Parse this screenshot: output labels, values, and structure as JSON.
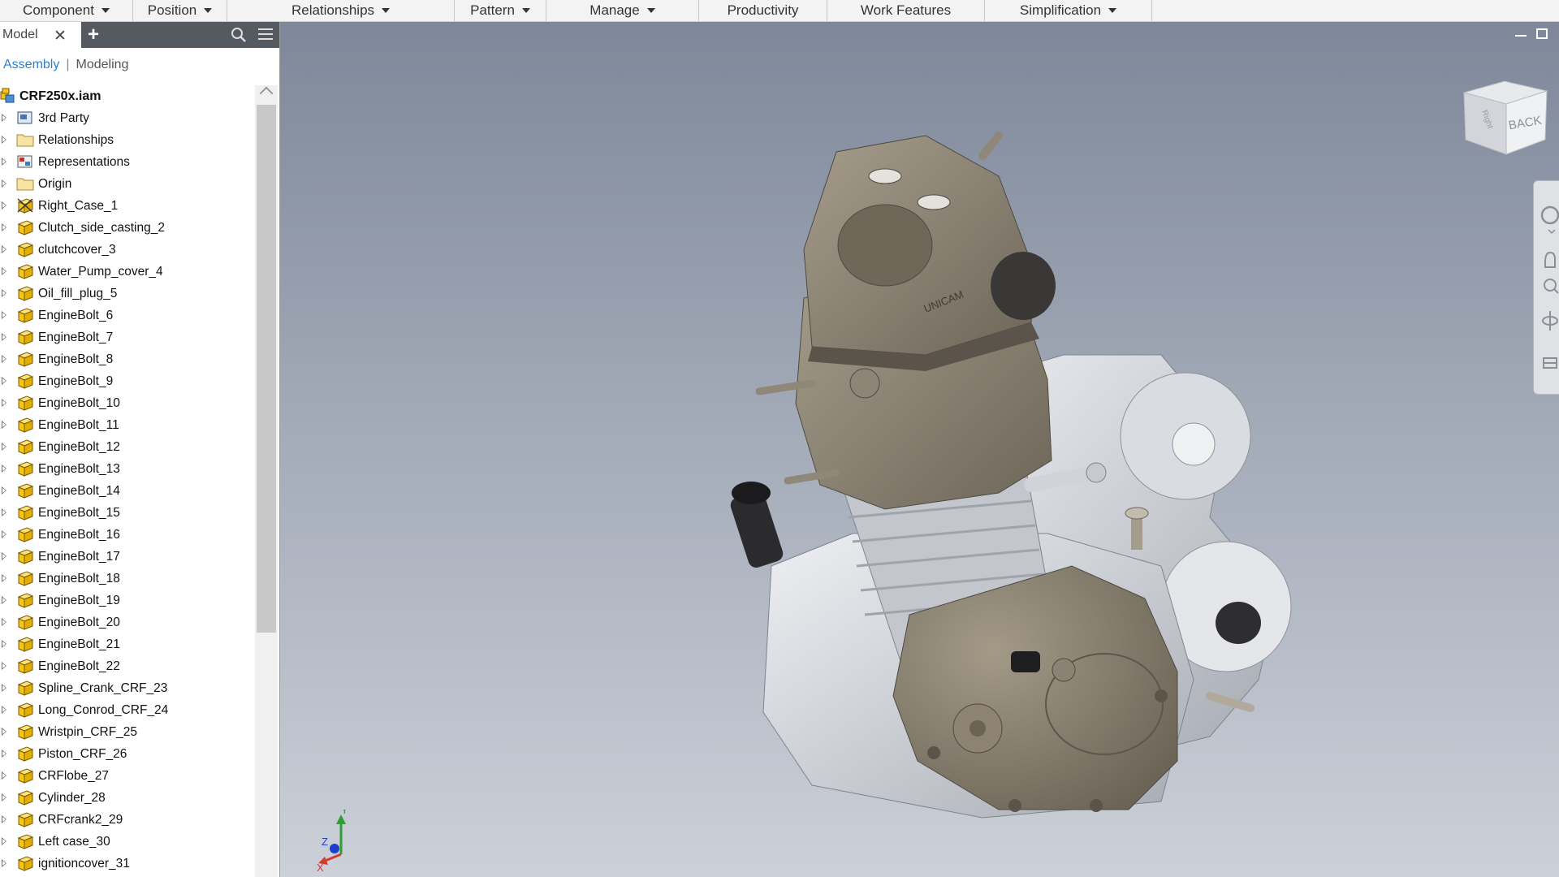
{
  "ribbon": {
    "groups": [
      {
        "label": "Component",
        "dropdown": true
      },
      {
        "label": "Position",
        "dropdown": true
      },
      {
        "label": "Relationships",
        "dropdown": true
      },
      {
        "label": "Pattern",
        "dropdown": true
      },
      {
        "label": "Manage",
        "dropdown": true
      },
      {
        "label": "Productivity",
        "dropdown": false
      },
      {
        "label": "Work Features",
        "dropdown": false
      },
      {
        "label": "Simplification",
        "dropdown": true
      }
    ]
  },
  "browser": {
    "tab_label": "Model",
    "view_assembly": "Assembly",
    "view_modeling": "Modeling",
    "root": "CRF250x.iam",
    "nodes": [
      {
        "label": "3rd Party",
        "icon": "third-party-icon"
      },
      {
        "label": "Relationships",
        "icon": "folder-icon"
      },
      {
        "label": "Representations",
        "icon": "representations-icon"
      },
      {
        "label": "Origin",
        "icon": "folder-icon"
      },
      {
        "label": "Right_Case_1",
        "icon": "grounded-part-icon"
      },
      {
        "label": "Clutch_side_casting_2",
        "icon": "part-icon"
      },
      {
        "label": "clutchcover_3",
        "icon": "part-icon"
      },
      {
        "label": "Water_Pump_cover_4",
        "icon": "part-icon"
      },
      {
        "label": "Oil_fill_plug_5",
        "icon": "part-icon"
      },
      {
        "label": "EngineBolt_6",
        "icon": "part-icon"
      },
      {
        "label": "EngineBolt_7",
        "icon": "part-icon"
      },
      {
        "label": "EngineBolt_8",
        "icon": "part-icon"
      },
      {
        "label": "EngineBolt_9",
        "icon": "part-icon"
      },
      {
        "label": "EngineBolt_10",
        "icon": "part-icon"
      },
      {
        "label": "EngineBolt_11",
        "icon": "part-icon"
      },
      {
        "label": "EngineBolt_12",
        "icon": "part-icon"
      },
      {
        "label": "EngineBolt_13",
        "icon": "part-icon"
      },
      {
        "label": "EngineBolt_14",
        "icon": "part-icon"
      },
      {
        "label": "EngineBolt_15",
        "icon": "part-icon"
      },
      {
        "label": "EngineBolt_16",
        "icon": "part-icon"
      },
      {
        "label": "EngineBolt_17",
        "icon": "part-icon"
      },
      {
        "label": "EngineBolt_18",
        "icon": "part-icon"
      },
      {
        "label": "EngineBolt_19",
        "icon": "part-icon"
      },
      {
        "label": "EngineBolt_20",
        "icon": "part-icon"
      },
      {
        "label": "EngineBolt_21",
        "icon": "part-icon"
      },
      {
        "label": "EngineBolt_22",
        "icon": "part-icon"
      },
      {
        "label": "Spline_Crank_CRF_23",
        "icon": "part-icon"
      },
      {
        "label": "Long_Conrod_CRF_24",
        "icon": "part-icon"
      },
      {
        "label": "Wristpin_CRF_25",
        "icon": "part-icon"
      },
      {
        "label": "Piston_CRF_26",
        "icon": "part-icon"
      },
      {
        "label": "CRFlobe_27",
        "icon": "part-icon"
      },
      {
        "label": "Cylinder_28",
        "icon": "part-icon"
      },
      {
        "label": "CRFcrank2_29",
        "icon": "part-icon"
      },
      {
        "label": "Left case_30",
        "icon": "part-icon"
      },
      {
        "label": "ignitioncover_31",
        "icon": "part-icon"
      }
    ]
  },
  "viewport": {
    "viewcube_face": "BACK",
    "viewcube_side": "Right",
    "engine_logo": "UNICAM",
    "triad": {
      "x": "X",
      "y": "Y",
      "z": "Z"
    }
  },
  "colors": {
    "selection_blue": "#2d7fcf",
    "part_icon_yellow": "#f5c518",
    "engine_bronze": "#8a8274",
    "engine_aluminium": "#d6d9de"
  }
}
